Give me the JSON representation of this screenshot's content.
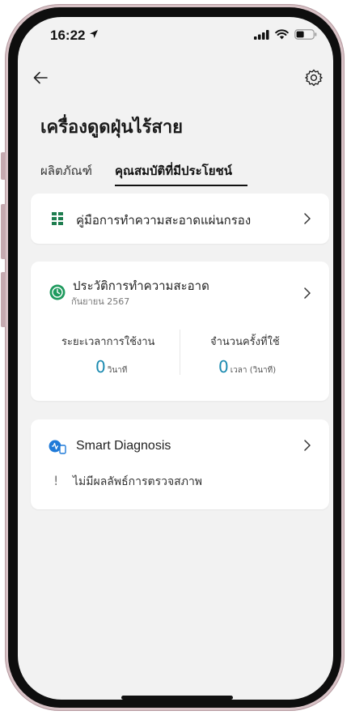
{
  "status_bar": {
    "time": "16:22"
  },
  "header": {
    "title": "เครื่องดูดฝุ่นไร้สาย"
  },
  "tabs": [
    {
      "label": "ผลิตภัณฑ์",
      "active": false
    },
    {
      "label": "คุณสมบัติที่มีประโยชน์",
      "active": true
    }
  ],
  "cards": {
    "filter_guide": {
      "title": "คู่มือการทำความสะอาดแผ่นกรอง"
    },
    "cleaning_history": {
      "title": "ประวัติการทำความสะอาด",
      "date": "กันยายน 2567",
      "usage_time": {
        "label": "ระยะเวลาการใช้งาน",
        "value": "0",
        "unit": "วินาที"
      },
      "usage_count": {
        "label": "จำนวนครั้งที่ใช้",
        "value": "0",
        "unit": "เวลา (วินาที)"
      }
    },
    "smart_diagnosis": {
      "title": "Smart Diagnosis",
      "message": "ไม่มีผลลัพธ์การตรวจสภาพ"
    }
  },
  "colors": {
    "accent_blue": "#1a8ab0",
    "grid_icon_green": "#1e7d4f",
    "clock_icon_green": "#1f9a5e",
    "diag_icon_blue": "#1f7ad8"
  }
}
